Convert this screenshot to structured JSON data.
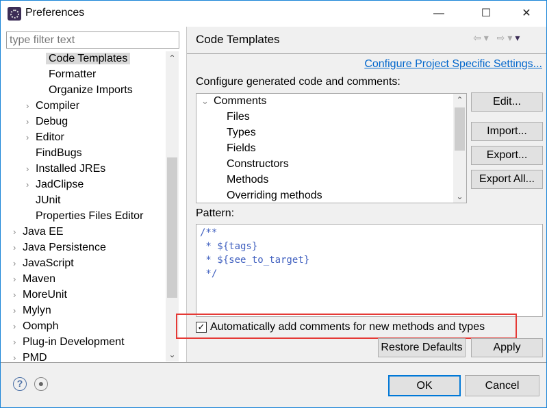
{
  "window": {
    "title": "Preferences",
    "minimize": "—",
    "maximize": "☐",
    "close": "✕"
  },
  "sidebar": {
    "filter_placeholder": "type filter text",
    "items": [
      {
        "label": "Code Templates",
        "level": 3,
        "arrow": false,
        "selected": true
      },
      {
        "label": "Formatter",
        "level": 3,
        "arrow": false
      },
      {
        "label": "Organize Imports",
        "level": 3,
        "arrow": false
      },
      {
        "label": "Compiler",
        "level": 2,
        "arrow": true
      },
      {
        "label": "Debug",
        "level": 2,
        "arrow": true
      },
      {
        "label": "Editor",
        "level": 2,
        "arrow": true
      },
      {
        "label": "FindBugs",
        "level": 2,
        "arrow": false
      },
      {
        "label": "Installed JREs",
        "level": 2,
        "arrow": true
      },
      {
        "label": "JadClipse",
        "level": 2,
        "arrow": true
      },
      {
        "label": "JUnit",
        "level": 2,
        "arrow": false
      },
      {
        "label": "Properties Files Editor",
        "level": 2,
        "arrow": false
      },
      {
        "label": "Java EE",
        "level": 1,
        "arrow": true
      },
      {
        "label": "Java Persistence",
        "level": 1,
        "arrow": true
      },
      {
        "label": "JavaScript",
        "level": 1,
        "arrow": true
      },
      {
        "label": "Maven",
        "level": 1,
        "arrow": true
      },
      {
        "label": "MoreUnit",
        "level": 1,
        "arrow": true
      },
      {
        "label": "Mylyn",
        "level": 1,
        "arrow": true
      },
      {
        "label": "Oomph",
        "level": 1,
        "arrow": true
      },
      {
        "label": "Plug-in Development",
        "level": 1,
        "arrow": true
      },
      {
        "label": "PMD",
        "level": 1,
        "arrow": true
      }
    ]
  },
  "main": {
    "title": "Code Templates",
    "project_link": "Configure Project Specific Settings...",
    "configure_label": "Configure generated code and comments:",
    "templates": [
      {
        "label": "Comments",
        "expanded": true
      },
      {
        "label": "Files"
      },
      {
        "label": "Types"
      },
      {
        "label": "Fields"
      },
      {
        "label": "Constructors"
      },
      {
        "label": "Methods"
      },
      {
        "label": "Overriding methods"
      }
    ],
    "buttons": {
      "edit": "Edit...",
      "import": "Import...",
      "export": "Export...",
      "export_all": "Export All..."
    },
    "pattern_label": "Pattern:",
    "pattern": "/**\n * ${tags}\n * ${see_to_target}\n */",
    "auto_comment": {
      "label": "Automatically add comments for new methods and types",
      "checked": true
    },
    "restore_defaults": "Restore Defaults",
    "apply": "Apply"
  },
  "footer": {
    "ok": "OK",
    "cancel": "Cancel"
  },
  "colors": {
    "link": "#0066cc",
    "highlight": "#e53935",
    "accent": "#1883d7"
  }
}
